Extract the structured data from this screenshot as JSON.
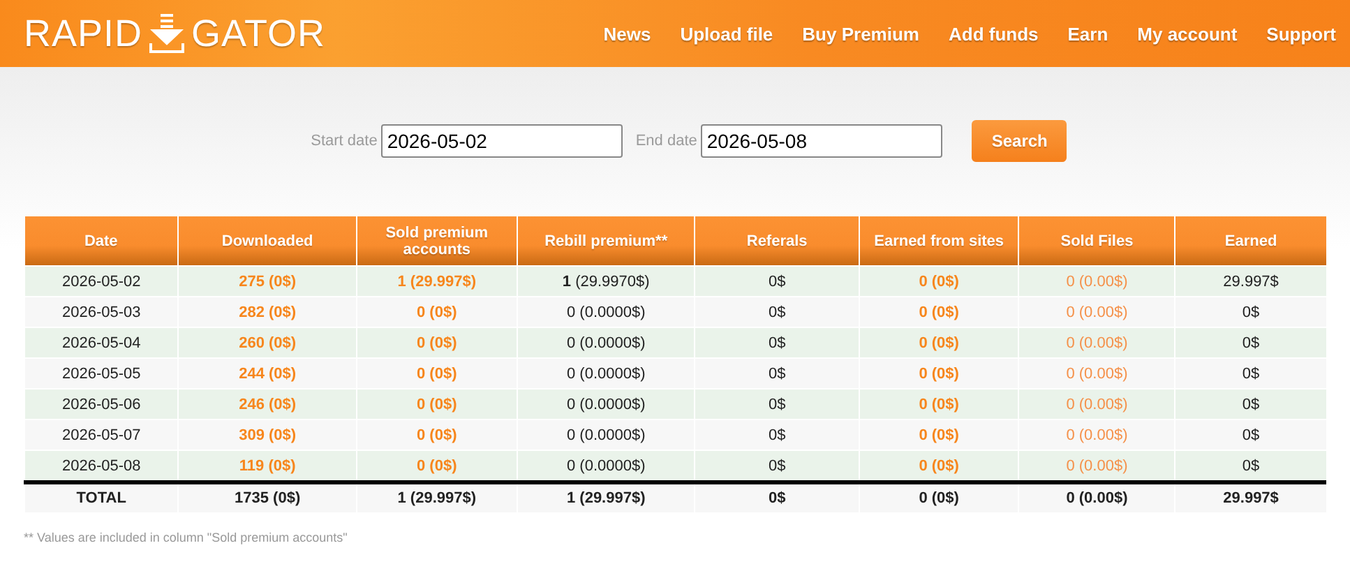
{
  "header": {
    "logo": {
      "left": "RAPID",
      "right": "GATOR"
    },
    "nav": [
      "News",
      "Upload file",
      "Buy Premium",
      "Add funds",
      "Earn",
      "My account",
      "Support"
    ]
  },
  "filter": {
    "start_label": "Start date",
    "start_value": "2026-05-02",
    "end_label": "End date",
    "end_value": "2026-05-08",
    "button": "Search"
  },
  "table": {
    "columns": [
      "Date",
      "Downloaded",
      "Sold premium accounts",
      "Rebill premium**",
      "Referals",
      "Earned from sites",
      "Sold Files",
      "Earned"
    ],
    "rows": [
      [
        {
          "text": "2026-05-02",
          "kind": "plain"
        },
        {
          "text": "275 (0$)",
          "kind": "link"
        },
        {
          "text": "1 (29.997$)",
          "kind": "link"
        },
        {
          "text": "**1** (29.9970$)",
          "kind": "plain"
        },
        {
          "text": "0$",
          "kind": "plain"
        },
        {
          "text": "0 (0$)",
          "kind": "link"
        },
        {
          "text": "0 (0.00$)",
          "kind": "link-light"
        },
        {
          "text": "29.997$",
          "kind": "plain"
        }
      ],
      [
        {
          "text": "2026-05-03",
          "kind": "plain"
        },
        {
          "text": "282 (0$)",
          "kind": "link"
        },
        {
          "text": "0 (0$)",
          "kind": "link"
        },
        {
          "text": "0 (0.0000$)",
          "kind": "plain"
        },
        {
          "text": "0$",
          "kind": "plain"
        },
        {
          "text": "0 (0$)",
          "kind": "link"
        },
        {
          "text": "0 (0.00$)",
          "kind": "link-light"
        },
        {
          "text": "0$",
          "kind": "plain"
        }
      ],
      [
        {
          "text": "2026-05-04",
          "kind": "plain"
        },
        {
          "text": "260 (0$)",
          "kind": "link"
        },
        {
          "text": "0 (0$)",
          "kind": "link"
        },
        {
          "text": "0 (0.0000$)",
          "kind": "plain"
        },
        {
          "text": "0$",
          "kind": "plain"
        },
        {
          "text": "0 (0$)",
          "kind": "link"
        },
        {
          "text": "0 (0.00$)",
          "kind": "link-light"
        },
        {
          "text": "0$",
          "kind": "plain"
        }
      ],
      [
        {
          "text": "2026-05-05",
          "kind": "plain"
        },
        {
          "text": "244 (0$)",
          "kind": "link"
        },
        {
          "text": "0 (0$)",
          "kind": "link"
        },
        {
          "text": "0 (0.0000$)",
          "kind": "plain"
        },
        {
          "text": "0$",
          "kind": "plain"
        },
        {
          "text": "0 (0$)",
          "kind": "link"
        },
        {
          "text": "0 (0.00$)",
          "kind": "link-light"
        },
        {
          "text": "0$",
          "kind": "plain"
        }
      ],
      [
        {
          "text": "2026-05-06",
          "kind": "plain"
        },
        {
          "text": "246 (0$)",
          "kind": "link"
        },
        {
          "text": "0 (0$)",
          "kind": "link"
        },
        {
          "text": "0 (0.0000$)",
          "kind": "plain"
        },
        {
          "text": "0$",
          "kind": "plain"
        },
        {
          "text": "0 (0$)",
          "kind": "link"
        },
        {
          "text": "0 (0.00$)",
          "kind": "link-light"
        },
        {
          "text": "0$",
          "kind": "plain"
        }
      ],
      [
        {
          "text": "2026-05-07",
          "kind": "plain"
        },
        {
          "text": "309 (0$)",
          "kind": "link"
        },
        {
          "text": "0 (0$)",
          "kind": "link"
        },
        {
          "text": "0 (0.0000$)",
          "kind": "plain"
        },
        {
          "text": "0$",
          "kind": "plain"
        },
        {
          "text": "0 (0$)",
          "kind": "link"
        },
        {
          "text": "0 (0.00$)",
          "kind": "link-light"
        },
        {
          "text": "0$",
          "kind": "plain"
        }
      ],
      [
        {
          "text": "2026-05-08",
          "kind": "plain"
        },
        {
          "text": "119 (0$)",
          "kind": "link"
        },
        {
          "text": "0 (0$)",
          "kind": "link"
        },
        {
          "text": "0 (0.0000$)",
          "kind": "plain"
        },
        {
          "text": "0$",
          "kind": "plain"
        },
        {
          "text": "0 (0$)",
          "kind": "link"
        },
        {
          "text": "0 (0.00$)",
          "kind": "link-light"
        },
        {
          "text": "0$",
          "kind": "plain"
        }
      ]
    ],
    "total": [
      "TOTAL",
      "1735 (0$)",
      "1 (29.997$)",
      "1 (29.997$)",
      "0$",
      "0 (0$)",
      "0 (0.00$)",
      "29.997$"
    ]
  },
  "footnote": "** Values are included in column \"Sold premium accounts\""
}
